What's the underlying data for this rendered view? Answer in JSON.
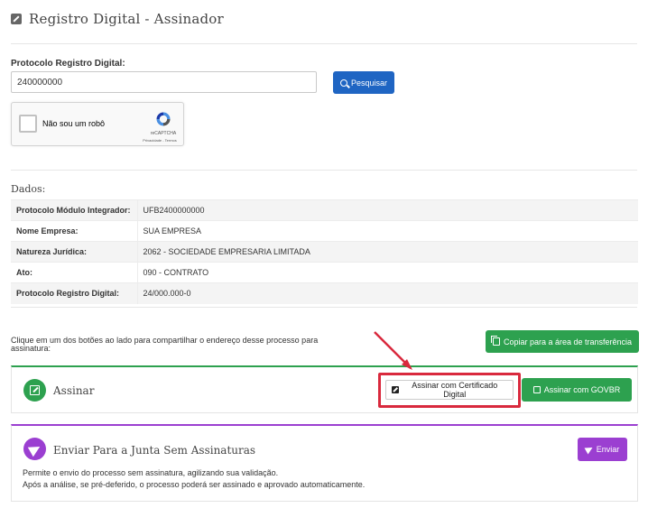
{
  "header": {
    "title": "Registro Digital - Assinador",
    "icon": "edit-square-icon"
  },
  "search": {
    "label": "Protocolo Registro Digital:",
    "value": "240000000",
    "button_label": "Pesquisar",
    "button_color": "#1f65c3"
  },
  "recaptcha": {
    "label": "Não sou um robô",
    "brand": "reCAPTCHA",
    "links": "Privacidade - Termos"
  },
  "dados": {
    "title": "Dados:",
    "rows": [
      {
        "key": "Protocolo Módulo Integrador:",
        "value": "UFB2400000000"
      },
      {
        "key": "Nome Empresa:",
        "value": "SUA EMPRESA"
      },
      {
        "key": "Natureza Jurídica:",
        "value": "2062 - SOCIEDADE EMPRESARIA LIMITADA"
      },
      {
        "key": "Ato:",
        "value": "090 - CONTRATO"
      },
      {
        "key": "Protocolo Registro Digital:",
        "value": "24/000.000-0"
      }
    ]
  },
  "share": {
    "text": "Clique em um dos botões ao lado para compartilhar o endereço desse processo para assinatura:",
    "copy_button_label": "Copiar para a área de transferência"
  },
  "assinar": {
    "title": "Assinar",
    "cert_button_label": "Assinar com Certificado Digital",
    "govbr_button_label": "Assinar com GOVBR",
    "accent_color": "#2da14f",
    "highlight_color": "#d9293d"
  },
  "enviar": {
    "title": "Enviar Para a Junta Sem Assinaturas",
    "button_label": "Enviar",
    "description_line1": "Permite o envio do processo sem assinatura, agilizando sua validação.",
    "description_line2": "Após a análise, se pré-deferido, o processo poderá ser assinado e aprovado automaticamente.",
    "accent_color": "#9b3fd1"
  }
}
